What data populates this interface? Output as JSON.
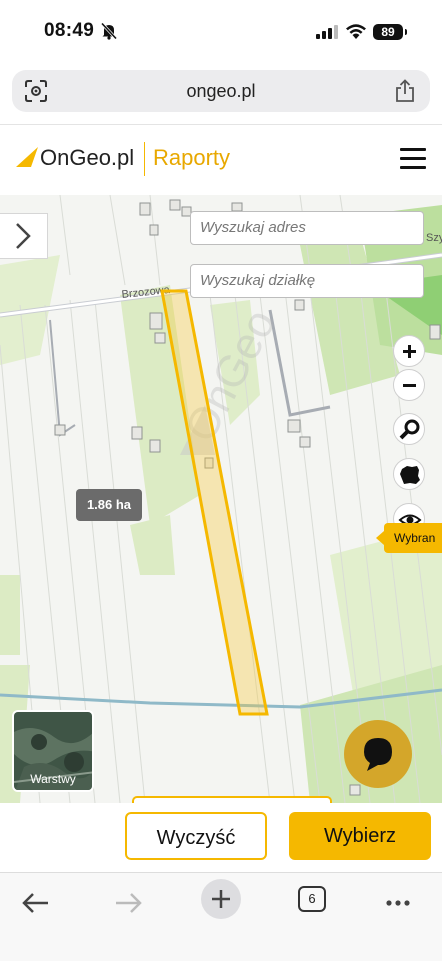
{
  "status_bar": {
    "time": "08:49",
    "battery": "89"
  },
  "browser": {
    "url": "ongeo.pl",
    "tab_count": "6"
  },
  "site": {
    "brand": "OnGeo.pl",
    "section": "Raporty",
    "accent_color": "#f5b800"
  },
  "map": {
    "search_address_placeholder": "Wyszukaj adres",
    "search_parcel_placeholder": "Wyszukaj działkę",
    "street_label": "Brzozowa",
    "street_label_2": "Szy",
    "watermark": "OnGeo",
    "area_label": "1.86 ha",
    "selected_tag": "Wybran",
    "zoom_in": "+",
    "zoom_out": "−",
    "layers_label": "Warstwy"
  },
  "actions": {
    "clear_label": "Wyczyść",
    "select_label": "Wybierz"
  }
}
